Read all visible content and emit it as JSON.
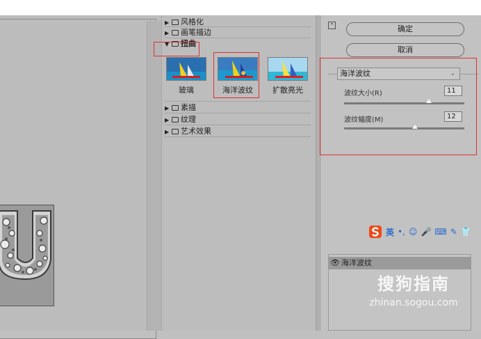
{
  "categories": [
    {
      "label": "风格化",
      "state": "collapsed"
    },
    {
      "label": "画笔描边",
      "state": "collapsed"
    },
    {
      "label": "扭曲",
      "state": "expanded"
    },
    {
      "label": "素描",
      "state": "collapsed"
    },
    {
      "label": "纹理",
      "state": "collapsed"
    },
    {
      "label": "艺术效果",
      "state": "collapsed"
    }
  ],
  "filters": [
    {
      "label": "玻璃",
      "selected": false
    },
    {
      "label": "海洋波纹",
      "selected": true
    },
    {
      "label": "扩散亮光",
      "selected": false
    }
  ],
  "buttons": {
    "ok": "确定",
    "cancel": "取消"
  },
  "filter_select": {
    "value": "海洋波纹"
  },
  "params": [
    {
      "label": "波纹大小(R)",
      "value": "11",
      "fraction": 0.73
    },
    {
      "label": "波纹幅度(M)",
      "value": "12",
      "fraction": 0.6
    }
  ],
  "ime": {
    "lang": "英"
  },
  "layers": {
    "effect_name": "海洋波纹"
  },
  "watermark": {
    "main": "搜狗指南",
    "sub": "zhinan.sogou.com"
  },
  "colors": {
    "highlight": "#e03030",
    "panel": "#c0c0c0"
  }
}
